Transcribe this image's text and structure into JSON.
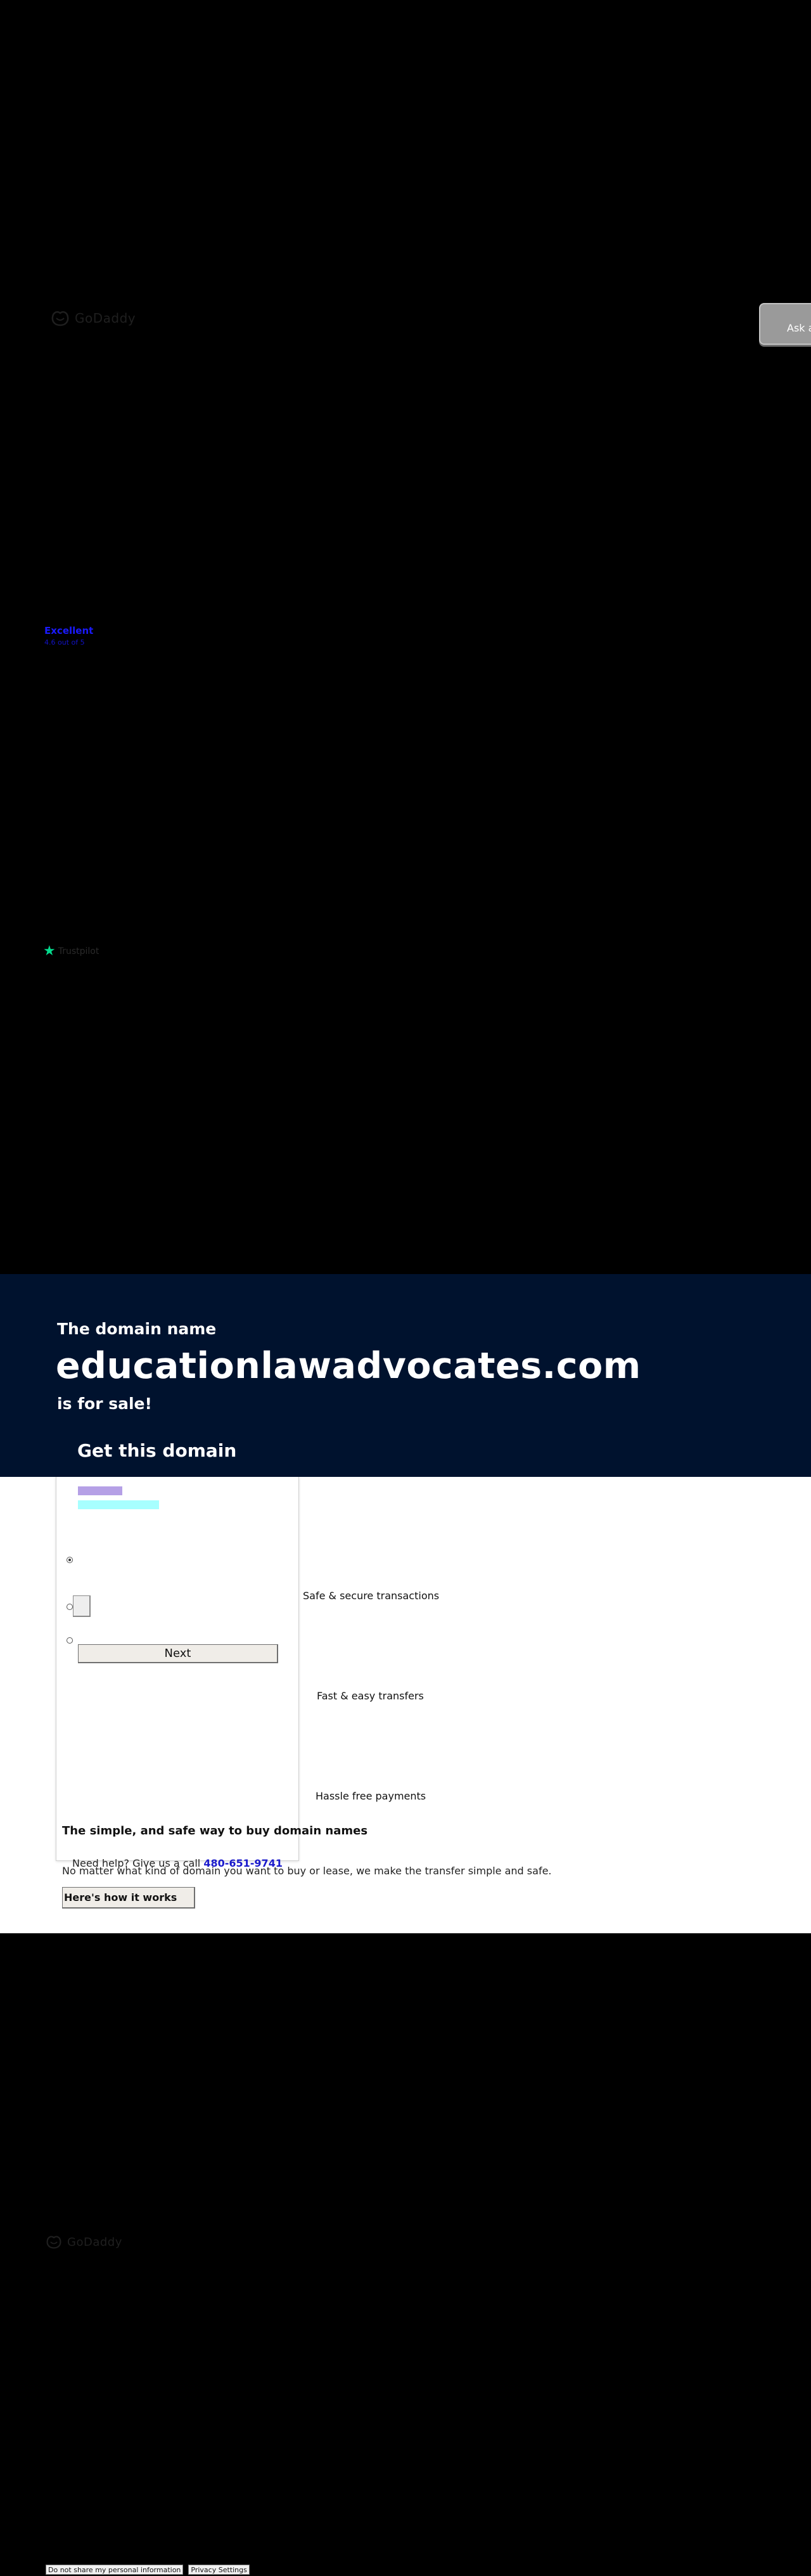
{
  "header": {
    "logo_text": "GoDaddy",
    "ask_tab_label": "Ask a"
  },
  "trust": {
    "rating_word": "Excellent",
    "rating_sub": "4.6 out of 5",
    "trustpilot_label": "Trustpilot"
  },
  "hero": {
    "prefix": "The domain name",
    "domain": "educationlawadvocates.com",
    "suffix": "is for sale!",
    "get_heading": "Get this domain"
  },
  "form": {
    "next_label": "Next"
  },
  "features": [
    {
      "label": "Safe & secure transactions"
    },
    {
      "label": "Fast & easy transfers"
    },
    {
      "label": "Hassle free payments"
    }
  ],
  "buy": {
    "heading": "The simple, and safe way to buy domain names",
    "help_text": "Need help? Give us a call",
    "phone": "480-651-9741",
    "description": "No matter what kind of domain you want to buy or lease, we make the transfer simple and safe.",
    "how_button": "Here's how it works"
  },
  "footer": {
    "logo_text": "GoDaddy",
    "do_not_share_label": "Do not share my personal information",
    "privacy_label": "Privacy Settings"
  },
  "colors": {
    "page_background": "#000000",
    "hero_background": "#00122e",
    "link_blue": "#1a1acc",
    "trustpilot_green": "#04da8d"
  },
  "icons": {
    "logo": "godaddy-logo-icon",
    "trustpilot": "trustpilot-star-icon"
  }
}
